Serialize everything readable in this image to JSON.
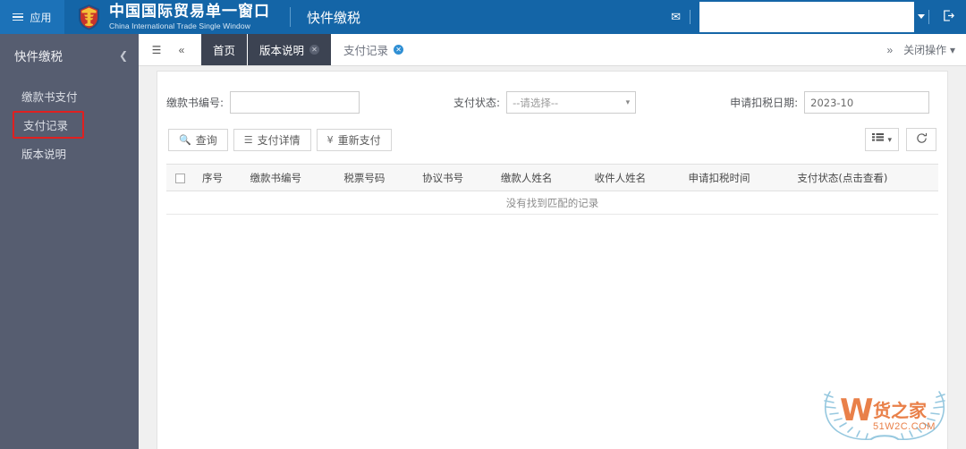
{
  "header": {
    "apps_label": "应用",
    "apps_icon": "hamburger-icon",
    "emblem_icon": "china-customs-emblem",
    "brand_cn": "中国国际贸易单一窗口",
    "brand_en": "China International Trade Single Window",
    "module_title": "快件缴税",
    "mail_icon": "envelope-icon",
    "user_value": "",
    "user_caret_icon": "chevron-down-icon",
    "logout_icon": "logout-icon"
  },
  "sidebar": {
    "title": "快件缴税",
    "collapse_icon": "chevron-left-icon",
    "items": [
      {
        "label": "缴款书支付",
        "highlighted": false
      },
      {
        "label": "支付记录",
        "highlighted": true
      },
      {
        "label": "版本说明",
        "highlighted": false
      }
    ]
  },
  "tabbar": {
    "menu_icon": "list-menu-icon",
    "prev_icon": "double-chevron-left-icon",
    "tabs": [
      {
        "label": "首页",
        "closable": false,
        "active": false
      },
      {
        "label": "版本说明",
        "closable": true,
        "active": false
      },
      {
        "label": "支付记录",
        "closable": true,
        "active": true
      }
    ],
    "close_icon": "circle-close-icon",
    "forward_icon": "double-chevron-right-icon",
    "close_ops_label": "关闭操作",
    "close_ops_caret": "caret-down-icon"
  },
  "search_form": {
    "doc_no": {
      "label": "缴款书编号:",
      "value": "",
      "placeholder": ""
    },
    "pay_status": {
      "label": "支付状态:",
      "value": "--请选择--",
      "caret_icon": "chevron-down-icon"
    },
    "tax_date": {
      "label": "申请扣税日期:",
      "value": "2023-10",
      "placeholder": ""
    }
  },
  "buttons": {
    "query": {
      "label": "查询",
      "icon": "search-icon"
    },
    "detail": {
      "label": "支付详情",
      "icon": "list-icon"
    },
    "repay": {
      "label": "重新支付",
      "icon": "yuan-icon"
    },
    "columns": {
      "label": "",
      "icon": "columns-list-icon",
      "caret": "caret-down-icon"
    },
    "refresh": {
      "label": "",
      "icon": "refresh-icon"
    }
  },
  "table": {
    "select_all_icon": "checkbox-icon",
    "columns": [
      "序号",
      "缴款书编号",
      "税票号码",
      "协议书号",
      "缴款人姓名",
      "收件人姓名",
      "申请扣税时间",
      "支付状态(点击查看)"
    ],
    "rows": [],
    "empty_text": "没有找到匹配的记录"
  },
  "watermark": {
    "letter": "W",
    "name": "货之家",
    "domain": "51W2C.COM"
  },
  "colors": {
    "header_blue": "#1465A7",
    "apps_blue": "#1C72B8",
    "sidebar_slate": "#565D70",
    "tab_dark": "#3C4352",
    "accent_red": "#e02020",
    "tab_close_blue": "#2f8fd4",
    "content_gray": "#f0f0f0"
  }
}
